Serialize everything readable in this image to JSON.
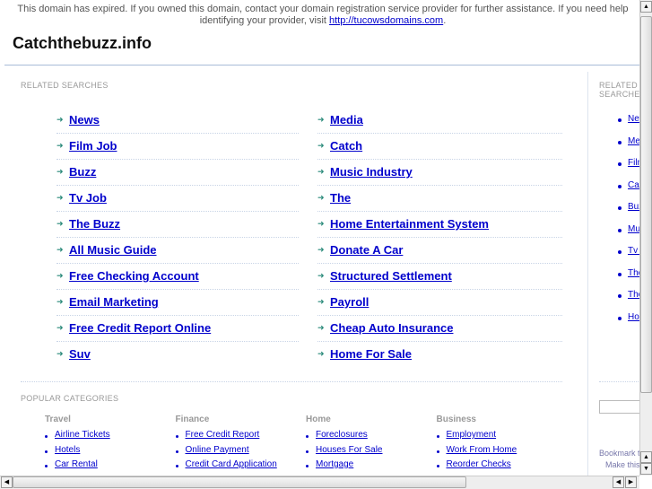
{
  "notice": {
    "text": "This domain has expired. If you owned this domain, contact your domain registration service provider for further assistance. If you need help identifying your provider, visit ",
    "link": "http://tucowsdomains.com",
    "end": "."
  },
  "site_title": "Catchthebuzz.info",
  "related": {
    "heading": "RELATED SEARCHES",
    "left": [
      "News",
      "Film Job",
      "Buzz",
      "Tv Job",
      "The Buzz",
      "All Music Guide",
      "Free Checking Account",
      "Email Marketing",
      "Free Credit Report Online",
      "Suv"
    ],
    "right": [
      "Media",
      "Catch",
      "Music Industry",
      "The",
      "Home Entertainment System",
      "Donate A Car",
      "Structured Settlement",
      "Payroll",
      "Cheap Auto Insurance",
      "Home For Sale"
    ]
  },
  "sidebar": {
    "heading": "RELATED SEARCHES",
    "items": [
      "News",
      "Media",
      "Film Job",
      "Catch",
      "Buzz",
      "Music Industry",
      "Tv Job",
      "The",
      "The Buzz",
      "Home Entertainment System"
    ],
    "search_value": "",
    "bookmark": "Bookmark this page",
    "make": "Make this your homepage"
  },
  "popular": {
    "heading": "POPULAR CATEGORIES",
    "columns": [
      {
        "title": "Travel",
        "links": [
          "Airline Tickets",
          "Hotels",
          "Car Rental"
        ]
      },
      {
        "title": "Finance",
        "links": [
          "Free Credit Report",
          "Online Payment",
          "Credit Card Application"
        ]
      },
      {
        "title": "Home",
        "links": [
          "Foreclosures",
          "Houses For Sale",
          "Mortgage"
        ]
      },
      {
        "title": "Business",
        "links": [
          "Employment",
          "Work From Home",
          "Reorder Checks"
        ]
      }
    ]
  },
  "colors": {
    "link": "#0000cc",
    "arrow": "#2a8a7a",
    "rule": "#a8bcd8"
  }
}
